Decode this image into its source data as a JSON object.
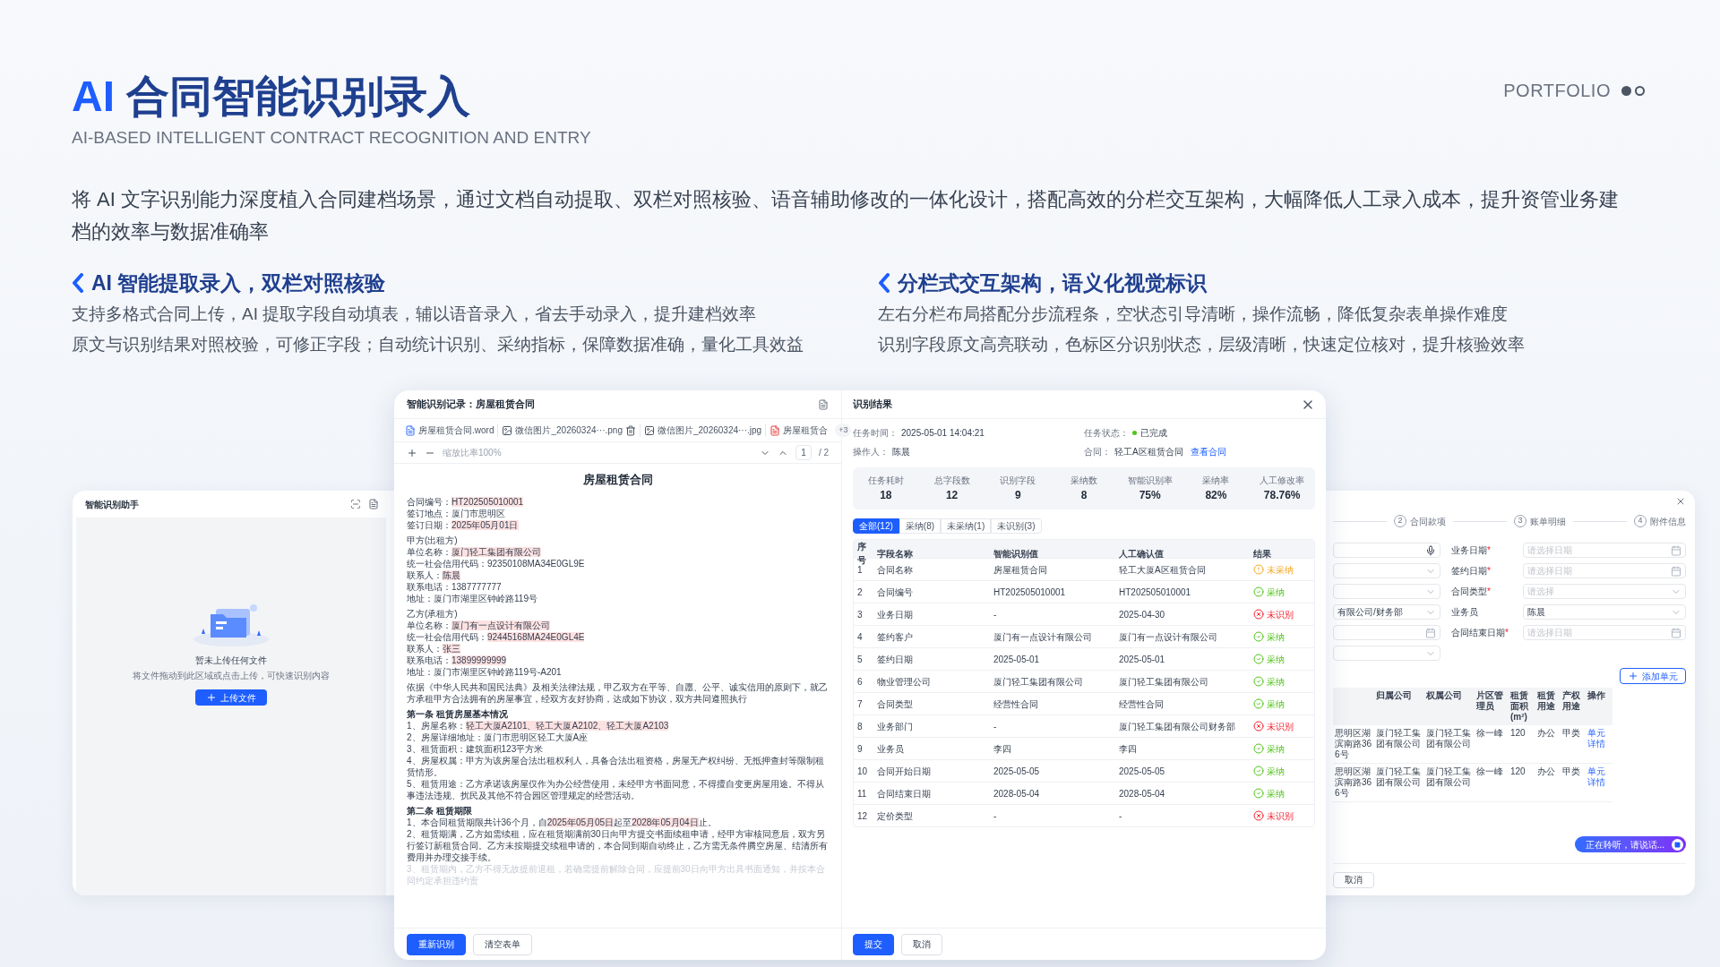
{
  "header": {
    "title_prefix": "AI",
    "title": "合同智能识别录入",
    "subtitle": "AI-BASED INTELLIGENT CONTRACT RECOGNITION AND ENTRY"
  },
  "portfolio": {
    "label": "PORTFOLIO",
    "pages": [
      {
        "selected": true
      },
      {
        "selected": false
      }
    ]
  },
  "intro": "将 AI 文字识别能力深度植入合同建档场景，通过文档自动提取、双栏对照核验、语音辅助修改的一体化设计，搭配高效的分栏交互架构，大幅降低人工录入成本，提升资管业务建档的效率与数据准确率",
  "features": [
    {
      "heading": "AI 智能提取录入，双栏对照核验",
      "lines": [
        "支持多格式合同上传，AI 提取字段自动填表，辅以语音录入，省去手动录入，提升建档效率",
        "原文与识别结果对照校验，可修正字段；自动统计识别、采纳指标，保障数据准确，量化工具效益"
      ]
    },
    {
      "heading": "分栏式交互架构，语义化视觉标识",
      "lines": [
        "左右分栏布局搭配分步流程条，空状态引导清晰，操作流畅，降低复杂表单操作难度",
        "识别字段原文高亮联动，色标区分识别状态，层级清晰，快速定位核对，提升核验效率"
      ]
    }
  ],
  "assistant": {
    "title": "智能识别助手",
    "empty_title": "暂未上传任何文件",
    "empty_hint": "将文件拖动到此区域或点击上传，可快速识别内容",
    "upload_button": "上传文件"
  },
  "record": {
    "title": "智能识别记录：房屋租赁合同",
    "files": [
      {
        "name": "房屋租赁合同.word",
        "kind": "word",
        "hovered": false
      },
      {
        "name": "微信图片_20260324···.png",
        "kind": "image",
        "hovered": true
      },
      {
        "name": "微信图片_20260324···.jpg",
        "kind": "image",
        "hovered": false
      },
      {
        "name": "房屋租赁合",
        "kind": "pdf",
        "hovered": false
      }
    ],
    "more_files": "+3",
    "zoom": "缩放比率100%",
    "page": "1",
    "page_total": "/ 2",
    "doc_title": "房屋租赁合同",
    "sections": [
      [
        {
          "kind": "line",
          "parts": [
            {
              "text": "合同编号：",
              "highlight": false
            },
            {
              "text": "HT202505010001",
              "highlight": true
            }
          ]
        },
        {
          "kind": "line",
          "parts": [
            {
              "text": "签订地点：厦门市思明区",
              "highlight": false
            }
          ]
        },
        {
          "kind": "line",
          "parts": [
            {
              "text": "签订日期：",
              "highlight": false
            },
            {
              "text": "2025年05月01日",
              "highlight": true
            }
          ]
        }
      ],
      [
        {
          "kind": "line",
          "parts": [
            {
              "text": "甲方(出租方)",
              "highlight": false
            }
          ]
        },
        {
          "kind": "line",
          "parts": [
            {
              "text": "单位名称：",
              "highlight": false
            },
            {
              "text": "厦门轻工集团有限公司",
              "highlight": true
            }
          ]
        },
        {
          "kind": "line",
          "parts": [
            {
              "text": "统一社会信用代码：92350108MA34E0GL9E",
              "highlight": false
            }
          ]
        },
        {
          "kind": "line",
          "parts": [
            {
              "text": "联系人：",
              "highlight": false
            },
            {
              "text": "陈晨",
              "highlight": true
            }
          ]
        },
        {
          "kind": "line",
          "parts": [
            {
              "text": "联系电话：1387777777",
              "highlight": false
            }
          ]
        },
        {
          "kind": "line",
          "parts": [
            {
              "text": "地址：厦门市湖里区钟岭路119号",
              "highlight": false
            }
          ]
        }
      ],
      [
        {
          "kind": "line",
          "parts": [
            {
              "text": "乙方(承租方)",
              "highlight": false
            }
          ]
        },
        {
          "kind": "line",
          "parts": [
            {
              "text": "单位名称：",
              "highlight": false
            },
            {
              "text": "厦门有一点设计有限公司",
              "highlight": true
            }
          ]
        },
        {
          "kind": "line",
          "parts": [
            {
              "text": "统一社会信用代码：",
              "highlight": false
            },
            {
              "text": "92445168MA24E0GL4E",
              "highlight": true
            }
          ]
        },
        {
          "kind": "line",
          "parts": [
            {
              "text": "联系人：",
              "highlight": false
            },
            {
              "text": "张三",
              "highlight": true
            }
          ]
        },
        {
          "kind": "line",
          "parts": [
            {
              "text": "联系电话：",
              "highlight": false
            },
            {
              "text": "13899999999",
              "highlight": true
            }
          ]
        },
        {
          "kind": "line",
          "parts": [
            {
              "text": "地址：厦门市湖里区钟岭路119号-A201",
              "highlight": false
            }
          ]
        }
      ],
      [
        {
          "kind": "line",
          "parts": [
            {
              "text": "依据《中华人民共和国民法典》及相关法律法规，甲乙双方在平等、自愿、公平、诚实信用的原则下，就乙方承租甲方合法拥有的房屋事宜，经双方友好协商，达成如下协议，双方共同遵照执行",
              "highlight": false
            }
          ]
        }
      ],
      [
        {
          "kind": "heading",
          "parts": [
            {
              "text": "第一条 租赁房屋基本情况",
              "highlight": false
            }
          ]
        },
        {
          "kind": "line",
          "parts": [
            {
              "text": "1、房屋名称：",
              "highlight": false
            },
            {
              "text": "轻工大厦A2101、轻工大厦A2102、轻工大厦A2103",
              "highlight": true
            }
          ]
        },
        {
          "kind": "line",
          "parts": [
            {
              "text": "2、房屋详细地址：厦门市思明区轻工大厦A座",
              "highlight": false
            }
          ]
        },
        {
          "kind": "line",
          "parts": [
            {
              "text": "3、租赁面积：建筑面积123平方米",
              "highlight": false
            }
          ]
        },
        {
          "kind": "line",
          "parts": [
            {
              "text": "4、房屋权属：甲方为该房屋合法出租权利人，具备合法出租资格，房屋无产权纠纷、无抵押查封等限制租赁情形。",
              "highlight": false
            }
          ]
        },
        {
          "kind": "line",
          "parts": [
            {
              "text": "5、租赁用途：乙方承诺该房屋仅作为办公经营使用，未经甲方书面同意，不得擅自变更房屋用途。不得从事违法违规、扰民及其他不符合园区管理规定的经营活动。",
              "highlight": false
            }
          ]
        }
      ],
      [
        {
          "kind": "heading",
          "parts": [
            {
              "text": "第二条 租赁期限",
              "highlight": false
            }
          ]
        },
        {
          "kind": "line",
          "parts": [
            {
              "text": "1、本合同租赁期限共计36个月，自",
              "highlight": false
            },
            {
              "text": "2025年05月05日",
              "highlight": true
            },
            {
              "text": "起至",
              "highlight": false
            },
            {
              "text": "2028年05月04日",
              "highlight": true
            },
            {
              "text": "止。",
              "highlight": false
            }
          ]
        },
        {
          "kind": "line",
          "parts": [
            {
              "text": "2、租赁期满，乙方如需续租，应在租赁期满前30日向甲方提交书面续租申请，经甲方审核同意后，双方另行签订新租赁合同。乙方未按期提交续租申请的，本合同到期自动终止，乙方需无条件腾空房屋、结清所有费用并办理交接手续。",
              "highlight": false
            }
          ]
        },
        {
          "kind": "faded",
          "parts": [
            {
              "text": "3、租赁期内，乙方不得无故提前退租，若确需提前解除合同，应提前30日向甲方出具书面通知，并按本合同约定承担违约责",
              "highlight": false
            }
          ]
        }
      ]
    ],
    "buttons": [
      {
        "label": "重新识别",
        "kind": "primary"
      },
      {
        "label": "清空表单",
        "kind": "default"
      }
    ]
  },
  "result": {
    "title": "识别结果",
    "meta": [
      {
        "label": "任务时间：",
        "value": "2025-05-01 14:04:21",
        "kind": "text"
      },
      {
        "label": "任务状态：",
        "value": "已完成",
        "kind": "status"
      },
      {
        "label": "操作人：",
        "value": "陈晨",
        "kind": "text"
      },
      {
        "label": "合同：",
        "value": "轻工A区租赁合同",
        "kind": "link",
        "link": "查看合同"
      }
    ],
    "stats": [
      {
        "label": "任务耗时",
        "value": "18"
      },
      {
        "label": "总字段数",
        "value": "12"
      },
      {
        "label": "识别字段",
        "value": "9"
      },
      {
        "label": "采纳数",
        "value": "8"
      },
      {
        "label": "智能识别率",
        "value": "75%"
      },
      {
        "label": "采纳率",
        "value": "82%"
      },
      {
        "label": "人工修改率",
        "value": "78.76%"
      }
    ],
    "tabs": [
      {
        "label": "全部(12)",
        "selected": true
      },
      {
        "label": "采纳(8)",
        "selected": false
      },
      {
        "label": "未采纳(1)",
        "selected": false
      },
      {
        "label": "未识别(3)",
        "selected": false
      }
    ],
    "columns": [
      "序号",
      "字段名称",
      "智能识别值",
      "人工确认值",
      "结果"
    ],
    "rows": [
      {
        "index": "1",
        "field": "合同名称",
        "ai_value": "房屋租赁合同",
        "confirmed": "轻工大厦A区租赁合同",
        "result": "未采纳",
        "kind": "rejected"
      },
      {
        "index": "2",
        "field": "合同编号",
        "ai_value": "HT202505010001",
        "confirmed": "HT202505010001",
        "result": "采纳",
        "kind": "adopted"
      },
      {
        "index": "3",
        "field": "业务日期",
        "ai_value": "-",
        "confirmed": "2025-04-30",
        "result": "未识别",
        "kind": "unrecognized"
      },
      {
        "index": "4",
        "field": "签约客户",
        "ai_value": "厦门有一点设计有限公司",
        "confirmed": "厦门有一点设计有限公司",
        "result": "采纳",
        "kind": "adopted"
      },
      {
        "index": "5",
        "field": "签约日期",
        "ai_value": "2025-05-01",
        "confirmed": "2025-05-01",
        "result": "采纳",
        "kind": "adopted"
      },
      {
        "index": "6",
        "field": "物业管理公司",
        "ai_value": "厦门轻工集团有限公司",
        "confirmed": "厦门轻工集团有限公司",
        "result": "采纳",
        "kind": "adopted"
      },
      {
        "index": "7",
        "field": "合同类型",
        "ai_value": "经营性合同",
        "confirmed": "经营性合同",
        "result": "采纳",
        "kind": "adopted"
      },
      {
        "index": "8",
        "field": "业务部门",
        "ai_value": "-",
        "confirmed": "厦门轻工集团有限公司财务部",
        "result": "未识别",
        "kind": "unrecognized"
      },
      {
        "index": "9",
        "field": "业务员",
        "ai_value": "李四",
        "confirmed": "李四",
        "result": "采纳",
        "kind": "adopted"
      },
      {
        "index": "10",
        "field": "合同开始日期",
        "ai_value": "2025-05-05",
        "confirmed": "2025-05-05",
        "result": "采纳",
        "kind": "adopted"
      },
      {
        "index": "11",
        "field": "合同结束日期",
        "ai_value": "2028-05-04",
        "confirmed": "2028-05-04",
        "result": "采纳",
        "kind": "adopted"
      },
      {
        "index": "12",
        "field": "定价类型",
        "ai_value": "-",
        "confirmed": "-",
        "result": "未识别",
        "kind": "unrecognized"
      }
    ],
    "buttons": [
      {
        "label": "提交",
        "kind": "primary"
      },
      {
        "label": "取消",
        "kind": "default"
      }
    ]
  },
  "entry_form": {
    "steps": [
      {
        "number": "2",
        "label": "合同款项"
      },
      {
        "number": "3",
        "label": "账单明细"
      },
      {
        "number": "4",
        "label": "附件信息"
      }
    ],
    "left_fields": [
      {
        "kind": "voice"
      },
      {
        "kind": "select"
      },
      {
        "kind": "select"
      },
      {
        "kind": "select",
        "value": "有限公司/财务部"
      },
      {
        "kind": "date"
      },
      {
        "kind": "select"
      }
    ],
    "right_fields": [
      {
        "label": "业务日期",
        "mark": "*",
        "kind": "date",
        "placeholder": "请选择日期"
      },
      {
        "label": "签约日期",
        "mark": "*",
        "kind": "date",
        "placeholder": "请选择日期"
      },
      {
        "label": "合同类型",
        "mark": "*",
        "kind": "select",
        "placeholder": "请选择"
      },
      {
        "label": "业务员",
        "kind": "select",
        "value": "陈晨"
      },
      {
        "label": "合同结束日期",
        "mark": "*",
        "kind": "date",
        "placeholder": "请选择日期"
      }
    ],
    "add_button": "添加单元",
    "columns": [
      "",
      "归属公司",
      "权属公司",
      "片区管理员",
      "租赁面积(m²)",
      "租赁用途",
      "产权用途",
      "操作"
    ],
    "rows": [
      [
        "思明区湖滨南路366号",
        "厦门轻工集团有限公司",
        "厦门轻工集团有限公司",
        "徐一峰",
        "120",
        "办公",
        "甲类",
        "单元详情"
      ],
      [
        "思明区湖滨南路366号",
        "厦门轻工集团有限公司",
        "厦门轻工集团有限公司",
        "徐一峰",
        "120",
        "办公",
        "甲类",
        "单元详情"
      ]
    ],
    "voice_status": "正在聆听，请说话...",
    "cancel_button": "取消"
  }
}
